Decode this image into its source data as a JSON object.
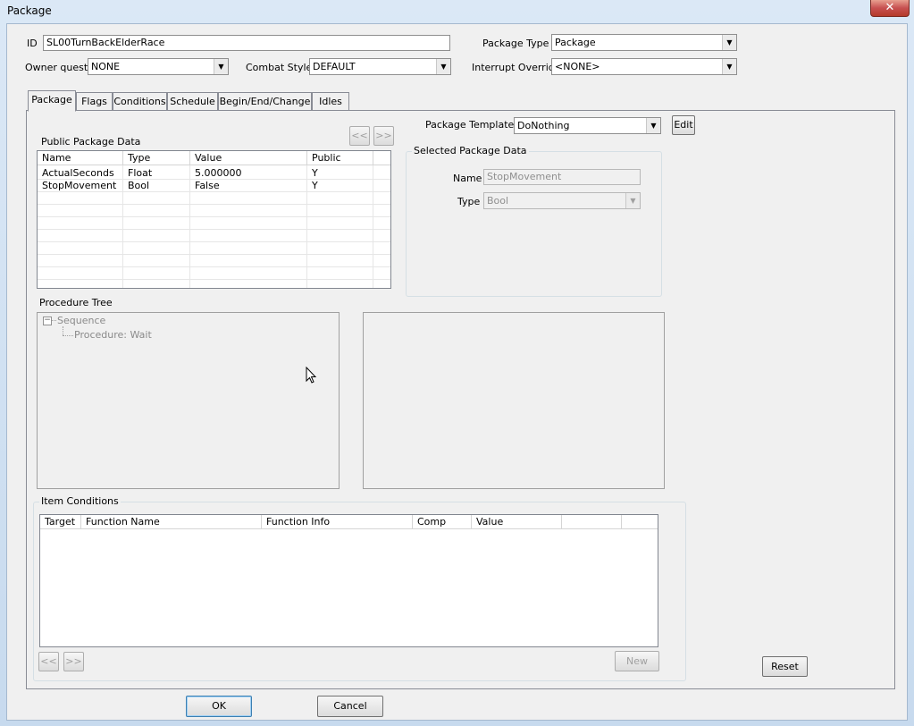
{
  "window": {
    "title": "Package",
    "close_glyph": "✕"
  },
  "header": {
    "id_label": "ID",
    "id_value": "SL00TurnBackElderRace",
    "package_type_label": "Package Type",
    "package_type_value": "Package",
    "owner_quest_label": "Owner quest",
    "owner_quest_value": "NONE",
    "combat_style_label": "Combat Style",
    "combat_style_value": "DEFAULT",
    "interrupt_override_label": "Interrupt Override",
    "interrupt_override_value": "<NONE>"
  },
  "tabs": [
    "Package",
    "Flags",
    "Conditions",
    "Schedule",
    "Begin/End/Change",
    "Idles"
  ],
  "template": {
    "label": "Package Template",
    "value": "DoNothing",
    "edit_label": "Edit"
  },
  "public_data": {
    "title": "Public Package Data",
    "prev_label": "<<",
    "next_label": ">>",
    "columns": [
      "Name",
      "Type",
      "Value",
      "Public"
    ],
    "rows": [
      [
        "ActualSeconds",
        "Float",
        "5.000000",
        "Y"
      ],
      [
        "StopMovement",
        "Bool",
        "False",
        "Y"
      ]
    ]
  },
  "selected_data": {
    "title": "Selected Package Data",
    "name_label": "Name",
    "name_value": "StopMovement",
    "type_label": "Type",
    "type_value": "Bool"
  },
  "procedure_tree": {
    "title": "Procedure Tree",
    "root_label": "Sequence",
    "child_label": "Procedure: Wait",
    "expander_glyph": "−"
  },
  "item_conditions": {
    "title": "Item Conditions",
    "columns": [
      "Target",
      "Function Name",
      "Function Info",
      "Comp",
      "Value",
      "",
      ""
    ],
    "prev_label": "<<",
    "next_label": ">>",
    "new_label": "New"
  },
  "buttons": {
    "reset": "Reset",
    "ok": "OK",
    "cancel": "Cancel"
  },
  "colors": {
    "titlebar": "#c9dcef",
    "panel": "#f0f0f0",
    "close": "#c75050"
  }
}
